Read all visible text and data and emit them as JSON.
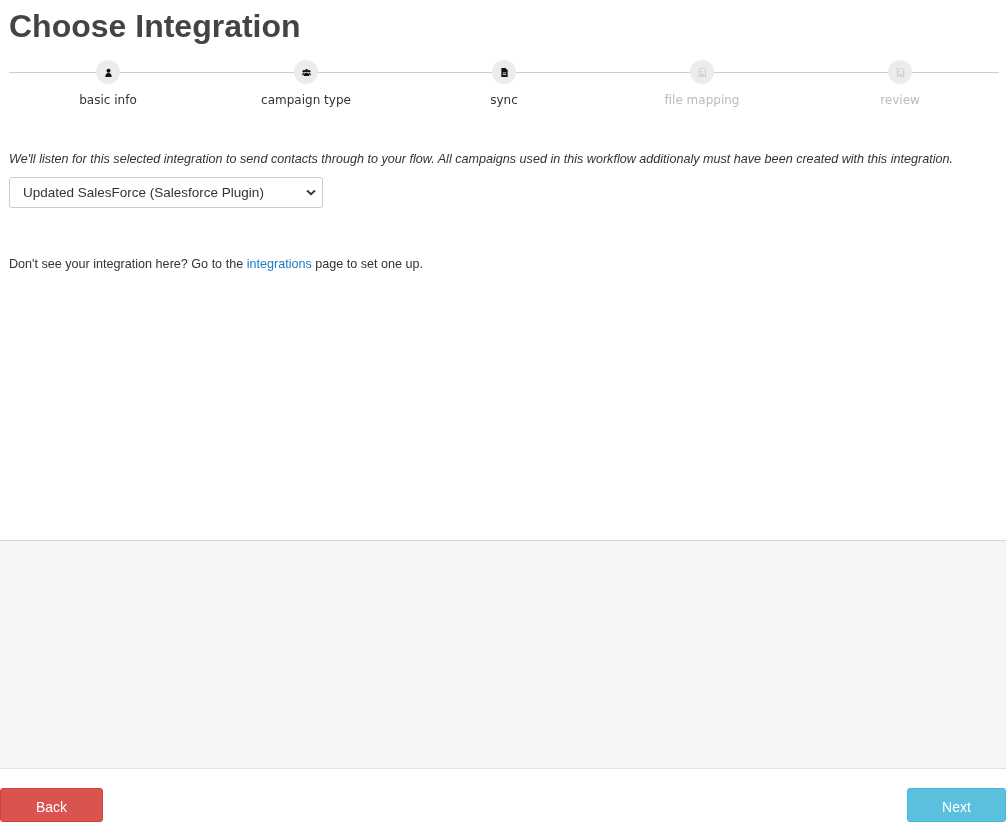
{
  "title": "Choose Integration",
  "steps": [
    {
      "label": "basic info",
      "kind": "person",
      "disabled": false
    },
    {
      "label": "campaign type",
      "kind": "group",
      "disabled": false
    },
    {
      "label": "sync",
      "kind": "file",
      "disabled": false
    },
    {
      "label": "file mapping",
      "kind": "image",
      "disabled": true
    },
    {
      "label": "review",
      "kind": "image",
      "disabled": true
    }
  ],
  "description": "We'll listen for this selected integration to send contacts through to your flow. All campaigns used in this workflow additionaly must have been created with this integration.",
  "integration_select": {
    "value": "Updated SalesForce (Salesforce Plugin)"
  },
  "help": {
    "before": "Don't see your integration here? Go to the ",
    "link": "integrations",
    "after": " page to set one up."
  },
  "buttons": [
    {
      "label": "Back",
      "kind": "back"
    },
    {
      "label": "Next",
      "kind": "next"
    }
  ]
}
